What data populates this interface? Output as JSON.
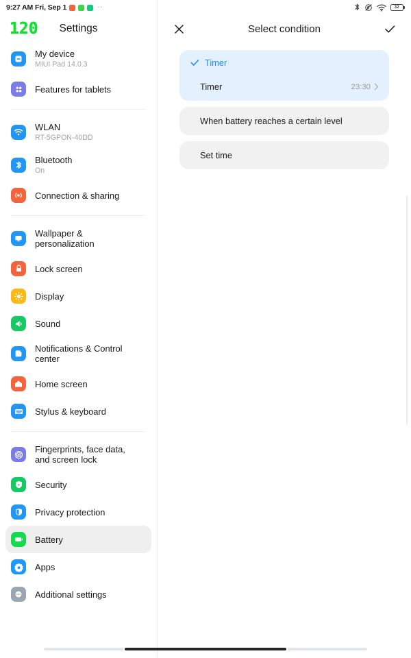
{
  "statusbar": {
    "time": "9:27 AM Fri, Sep 1",
    "app_icons": [
      {
        "name": "status-app-icon-orange",
        "color": "#f4643c"
      },
      {
        "name": "status-app-icon-green",
        "color": "#3ed44a"
      },
      {
        "name": "status-app-icon-teal",
        "color": "#16c97e"
      }
    ],
    "overflow_dots": "··",
    "icons": [
      "bluetooth-icon",
      "mute-icon",
      "wifi-icon",
      "battery-icon"
    ],
    "battery_level": "32"
  },
  "sidebar": {
    "refresh_rate_badge": "120",
    "title": "Settings",
    "groups": [
      {
        "items": [
          {
            "label": "My device",
            "sub": "MIUI Pad 14.0.3",
            "icon": "device-icon",
            "color": "#2196f3",
            "selected": false
          },
          {
            "label": "Features for tablets",
            "sub": "",
            "icon": "tablet-features-icon",
            "color": "#7c7ce8",
            "selected": false
          }
        ]
      },
      {
        "items": [
          {
            "label": "WLAN",
            "sub": "RT-5GPON-40DD",
            "icon": "wifi-icon",
            "color": "#2196f3",
            "selected": false
          },
          {
            "label": "Bluetooth",
            "sub": "On",
            "icon": "bluetooth-icon",
            "color": "#2196f3",
            "selected": false
          },
          {
            "label": "Connection & sharing",
            "sub": "",
            "icon": "connection-sharing-icon",
            "color": "#f4643c",
            "selected": false
          }
        ]
      },
      {
        "items": [
          {
            "label": "Wallpaper & personalization",
            "sub": "",
            "icon": "wallpaper-icon",
            "color": "#2196f3",
            "selected": false
          },
          {
            "label": "Lock screen",
            "sub": "",
            "icon": "lock-icon",
            "color": "#f4643c",
            "selected": false
          },
          {
            "label": "Display",
            "sub": "",
            "icon": "display-brightness-icon",
            "color": "#fcb914",
            "selected": false
          },
          {
            "label": "Sound",
            "sub": "",
            "icon": "sound-speaker-icon",
            "color": "#17c964",
            "selected": false
          },
          {
            "label": "Notifications & Control center",
            "sub": "",
            "icon": "notifications-icon",
            "color": "#2196f3",
            "selected": false
          },
          {
            "label": "Home screen",
            "sub": "",
            "icon": "home-icon",
            "color": "#f4643c",
            "selected": false
          },
          {
            "label": "Stylus & keyboard",
            "sub": "",
            "icon": "keyboard-icon",
            "color": "#2196f3",
            "selected": false
          }
        ]
      },
      {
        "items": [
          {
            "label": "Fingerprints, face data, and screen lock",
            "sub": "",
            "icon": "fingerprint-icon",
            "color": "#7c7ce8",
            "selected": false
          },
          {
            "label": "Security",
            "sub": "",
            "icon": "security-shield-icon",
            "color": "#17c964",
            "selected": false
          },
          {
            "label": "Privacy protection",
            "sub": "",
            "icon": "privacy-icon",
            "color": "#2196f3",
            "selected": false
          },
          {
            "label": "Battery",
            "sub": "",
            "icon": "battery-icon",
            "color": "#17d94e",
            "selected": true
          },
          {
            "label": "Apps",
            "sub": "",
            "icon": "apps-icon",
            "color": "#2196f3",
            "selected": false
          },
          {
            "label": "Additional settings",
            "sub": "",
            "icon": "additional-settings-icon",
            "color": "#9aa6b2",
            "selected": false
          }
        ]
      }
    ]
  },
  "panel": {
    "title": "Select condition",
    "close_icon": "close-icon",
    "confirm_icon": "check-icon",
    "options": [
      {
        "id": "timer",
        "label": "Timer",
        "selected": true,
        "sub_row": {
          "label": "Timer",
          "value": "23:30",
          "chevron": "chevron-right-icon"
        }
      },
      {
        "id": "battery-level",
        "label": "When battery reaches a certain level",
        "selected": false
      },
      {
        "id": "set-time",
        "label": "Set time",
        "selected": false
      }
    ]
  },
  "colors": {
    "accent_blue": "#1a8cf0",
    "selected_card": "#e3f0fd",
    "card": "#f1f1f1",
    "sidebar_selected": "#efefef",
    "refresh_green": "#12e02e"
  }
}
